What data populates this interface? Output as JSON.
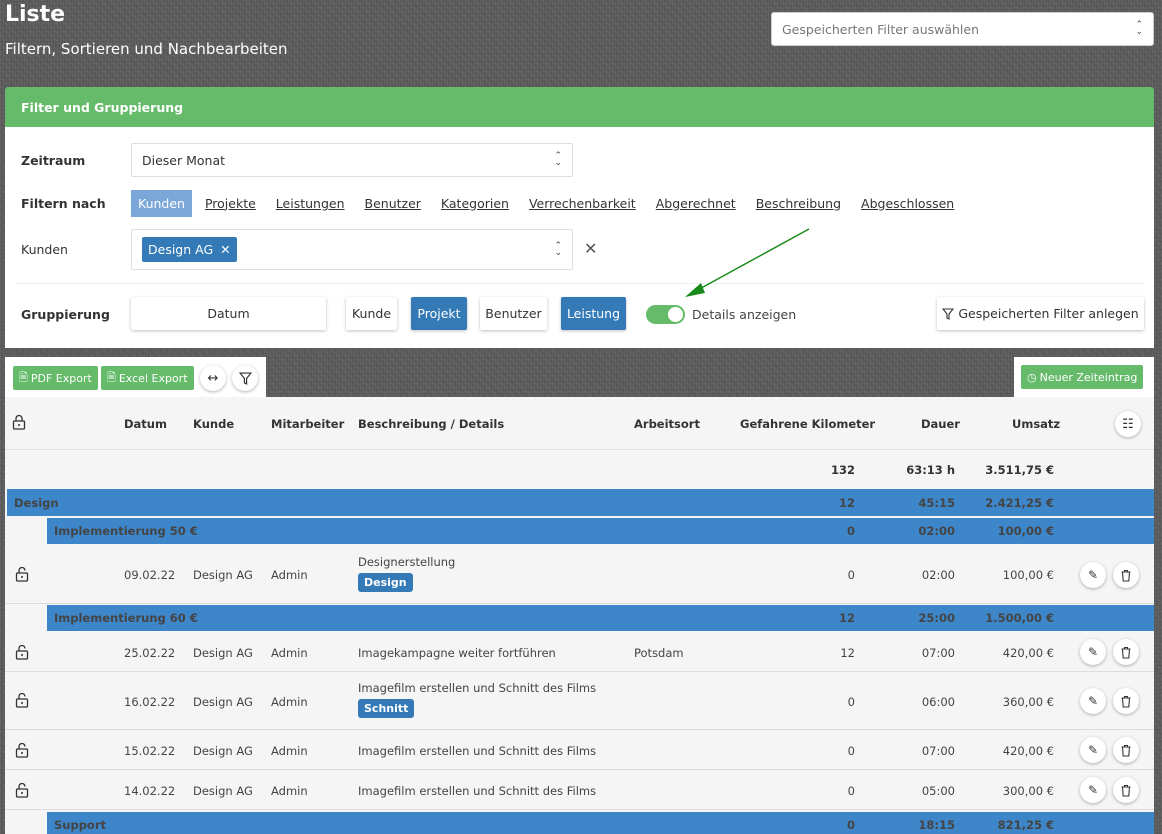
{
  "page": {
    "title": "Liste",
    "subtitle": "Filtern, Sortieren und Nachbearbeiten"
  },
  "saved_filter": {
    "placeholder": "Gespeicherten Filter auswählen"
  },
  "filter_panel": {
    "title": "Filter und Gruppierung",
    "period_label": "Zeitraum",
    "period_value": "Dieser Monat",
    "filter_by_label": "Filtern nach",
    "filter_tabs": [
      "Kunden",
      "Projekte",
      "Leistungen",
      "Benutzer",
      "Kategorien",
      "Verrechenbarkeit",
      "Abgerechnet",
      "Beschreibung",
      "Abgeschlossen"
    ],
    "customers_label": "Kunden",
    "customer_tag": "Design AG",
    "grouping_label": "Gruppierung",
    "grouping": {
      "date": "Datum",
      "customer": "Kunde",
      "project": "Projekt",
      "user": "Benutzer",
      "service": "Leistung"
    },
    "details_label": "Details anzeigen",
    "save_filter_label": "Gespeicherten Filter anlegen"
  },
  "toolbar": {
    "pdf": "PDF Export",
    "excel": "Excel Export",
    "new_entry": "Neuer Zeiteintrag"
  },
  "columns": {
    "date": "Datum",
    "customer": "Kunde",
    "employee": "Mitarbeiter",
    "description": "Beschreibung / Details",
    "location": "Arbeitsort",
    "km": "Gefahrene Kilometer",
    "duration": "Dauer",
    "revenue": "Umsatz"
  },
  "totals": {
    "km": "132",
    "duration": "63:13 h",
    "revenue": "3.511,75 €"
  },
  "groups": {
    "design": {
      "name": "Design",
      "km": "12",
      "duration": "45:15",
      "revenue": "2.421,25 €"
    },
    "impl50": {
      "name": "Implementierung 50 €",
      "km": "0",
      "duration": "02:00",
      "revenue": "100,00 €"
    },
    "impl60": {
      "name": "Implementierung 60 €",
      "km": "12",
      "duration": "25:00",
      "revenue": "1.500,00 €"
    },
    "support": {
      "name": "Support",
      "km": "0",
      "duration": "18:15",
      "revenue": "821,25 €"
    }
  },
  "rows": [
    {
      "date": "09.02.22",
      "customer": "Design AG",
      "employee": "Admin",
      "description": "Designerstellung",
      "tag": "Design",
      "location": "",
      "km": "0",
      "duration": "02:00",
      "revenue": "100,00 €"
    },
    {
      "date": "25.02.22",
      "customer": "Design AG",
      "employee": "Admin",
      "description": "Imagekampagne weiter fortführen",
      "tag": "",
      "location": "Potsdam",
      "km": "12",
      "duration": "07:00",
      "revenue": "420,00 €"
    },
    {
      "date": "16.02.22",
      "customer": "Design AG",
      "employee": "Admin",
      "description": "Imagefilm erstellen und Schnitt des Films",
      "tag": "Schnitt",
      "location": "",
      "km": "0",
      "duration": "06:00",
      "revenue": "360,00 €"
    },
    {
      "date": "15.02.22",
      "customer": "Design AG",
      "employee": "Admin",
      "description": "Imagefilm erstellen und Schnitt des Films",
      "tag": "",
      "location": "",
      "km": "0",
      "duration": "07:00",
      "revenue": "420,00 €"
    },
    {
      "date": "14.02.22",
      "customer": "Design AG",
      "employee": "Admin",
      "description": "Imagefilm erstellen und Schnitt des Films",
      "tag": "",
      "location": "",
      "km": "0",
      "duration": "05:00",
      "revenue": "300,00 €"
    }
  ],
  "icons": [
    "unlock-icon",
    "pencil-icon",
    "trash-icon",
    "filter-icon",
    "arrows-horizontal-icon",
    "columns-icon",
    "clock-icon",
    "file-icon",
    "close-icon"
  ],
  "colors": {
    "green": "#66bb6a",
    "blue": "#337ab7",
    "group_blue": "#3d86c9",
    "arrow": "#1a8a1a"
  }
}
